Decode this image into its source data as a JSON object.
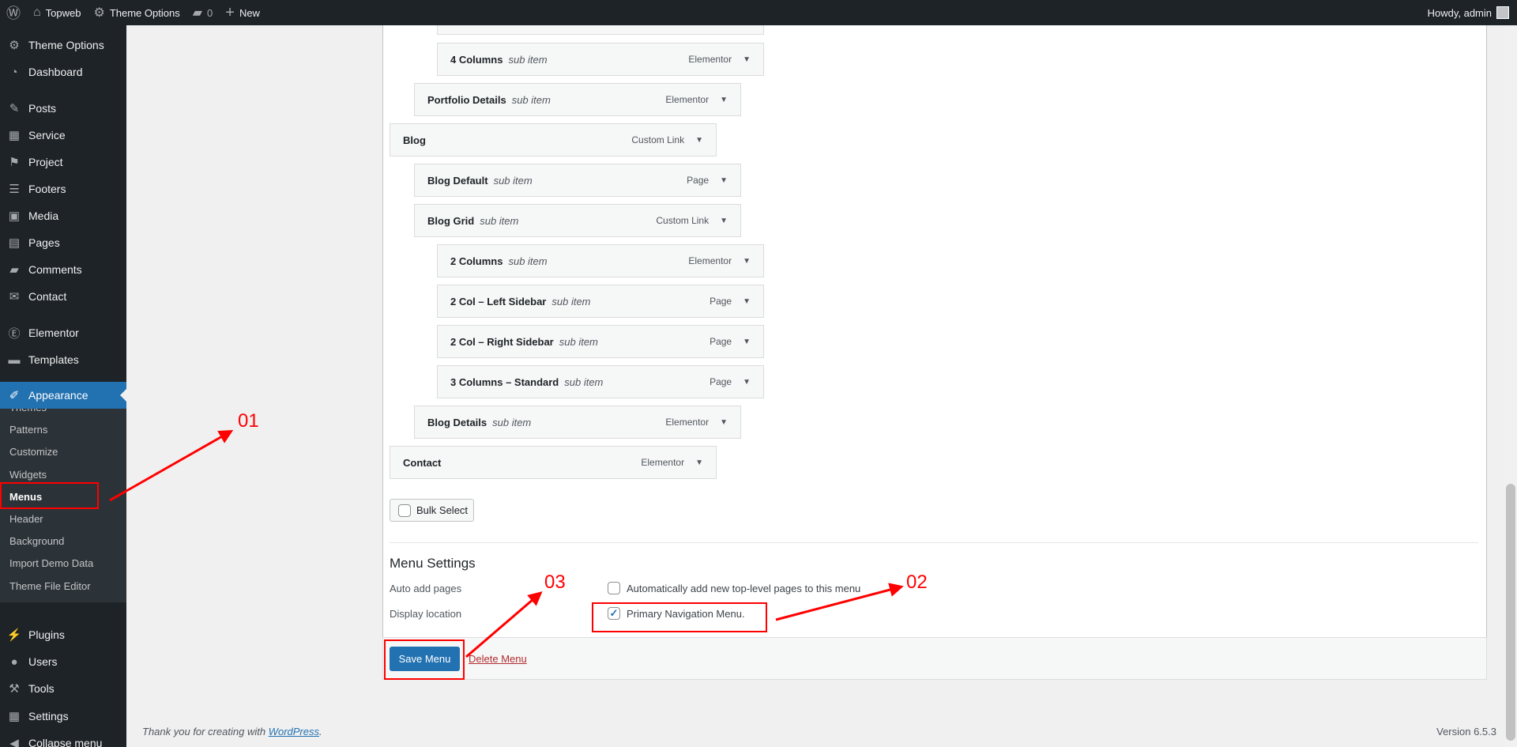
{
  "adminbar": {
    "site": "Topweb",
    "theme_options": "Theme Options",
    "comments": "0",
    "new": "New",
    "howdy": "Howdy, admin"
  },
  "sidebar": {
    "items": [
      {
        "label": "Theme Options",
        "icon": "gear-icon"
      },
      {
        "label": "Dashboard",
        "icon": "dashboard-icon"
      },
      {
        "label": "Posts",
        "icon": "pin-icon"
      },
      {
        "label": "Service",
        "icon": "grid-icon"
      },
      {
        "label": "Project",
        "icon": "flag-icon"
      },
      {
        "label": "Footers",
        "icon": "list-icon"
      },
      {
        "label": "Media",
        "icon": "media-icon"
      },
      {
        "label": "Pages",
        "icon": "pages-icon"
      },
      {
        "label": "Comments",
        "icon": "comment-icon"
      },
      {
        "label": "Contact",
        "icon": "mail-icon"
      },
      {
        "label": "Elementor",
        "icon": "elementor-icon"
      },
      {
        "label": "Templates",
        "icon": "folder-icon"
      },
      {
        "label": "Appearance",
        "icon": "brush-icon",
        "active": true
      },
      {
        "label": "Plugins",
        "icon": "plugin-icon"
      },
      {
        "label": "Users",
        "icon": "user-icon"
      },
      {
        "label": "Tools",
        "icon": "wrench-icon"
      },
      {
        "label": "Settings",
        "icon": "settings-icon"
      },
      {
        "label": "Collapse menu",
        "icon": "collapse-icon"
      }
    ],
    "submenu": [
      "Themes",
      "Patterns",
      "Customize",
      "Widgets",
      "Menus",
      "Header",
      "Background",
      "Import Demo Data",
      "Theme File Editor"
    ],
    "current_submenu": "Menus"
  },
  "menu_items": [
    {
      "title": "4 Columns",
      "sub": "sub item",
      "type": "Elementor",
      "depth": 2
    },
    {
      "title": "Portfolio Details",
      "sub": "sub item",
      "type": "Elementor",
      "depth": 1
    },
    {
      "title": "Blog",
      "sub": "",
      "type": "Custom Link",
      "depth": 0
    },
    {
      "title": "Blog Default",
      "sub": "sub item",
      "type": "Page",
      "depth": 1
    },
    {
      "title": "Blog Grid",
      "sub": "sub item",
      "type": "Custom Link",
      "depth": 1
    },
    {
      "title": "2 Columns",
      "sub": "sub item",
      "type": "Elementor",
      "depth": 2
    },
    {
      "title": "2 Col – Left Sidebar",
      "sub": "sub item",
      "type": "Page",
      "depth": 2
    },
    {
      "title": "2 Col – Right Sidebar",
      "sub": "sub item",
      "type": "Page",
      "depth": 2
    },
    {
      "title": "3 Columns – Standard",
      "sub": "sub item",
      "type": "Page",
      "depth": 2
    },
    {
      "title": "Blog Details",
      "sub": "sub item",
      "type": "Elementor",
      "depth": 1
    },
    {
      "title": "Contact",
      "sub": "",
      "type": "Elementor",
      "depth": 0
    }
  ],
  "bulk_select": "Bulk Select",
  "settings": {
    "heading": "Menu Settings",
    "auto_add_label": "Auto add pages",
    "auto_add_text": "Automatically add new top-level pages to this menu",
    "auto_add_checked": false,
    "location_label": "Display location",
    "location_text": "Primary Navigation Menu.",
    "location_checked": true
  },
  "actions": {
    "save": "Save Menu",
    "delete": "Delete Menu"
  },
  "footer": {
    "thanks": "Thank you for creating with ",
    "wp_link": "WordPress",
    "period": ".",
    "version": "Version 6.5.3"
  },
  "annotations": {
    "a1": "01",
    "a2": "02",
    "a3": "03",
    "color": "#ff0000"
  }
}
